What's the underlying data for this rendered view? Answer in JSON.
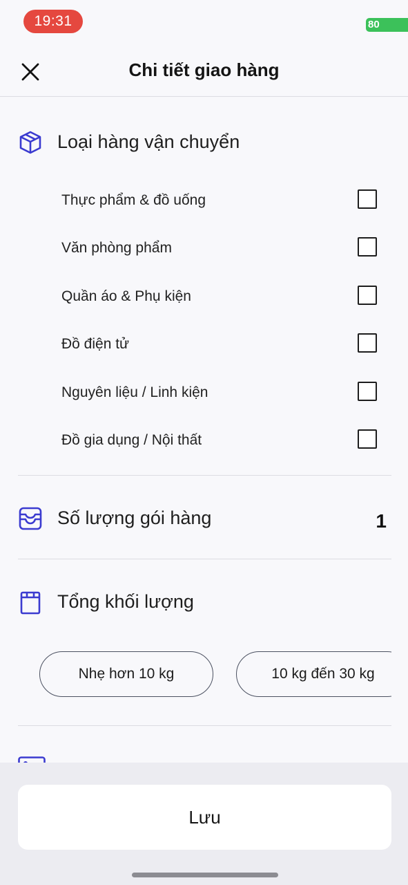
{
  "status_bar": {
    "time": "19:31",
    "battery": "80"
  },
  "header": {
    "title": "Chi tiết giao hàng"
  },
  "cargo_type": {
    "title": "Loại hàng vận chuyển",
    "items": [
      {
        "label": "Thực phẩm & đồ uống",
        "checked": false
      },
      {
        "label": "Văn phòng phẩm",
        "checked": false
      },
      {
        "label": "Quần áo & Phụ kiện",
        "checked": false
      },
      {
        "label": "Đồ điện tử",
        "checked": false
      },
      {
        "label": "Nguyên liệu / Linh kiện",
        "checked": false
      },
      {
        "label": "Đồ gia dụng / Nội thất",
        "checked": false
      }
    ]
  },
  "package_count": {
    "title": "Số lượng gói hàng",
    "value": "1"
  },
  "total_weight": {
    "title": "Tổng khối lượng",
    "options": [
      "Nhẹ hơn 10 kg",
      "10 kg đến 30 kg"
    ]
  },
  "footer": {
    "save_label": "Lưu"
  },
  "colors": {
    "accent": "#3b3bd0",
    "status_pill": "#e5483f",
    "battery": "#3cc15a"
  }
}
